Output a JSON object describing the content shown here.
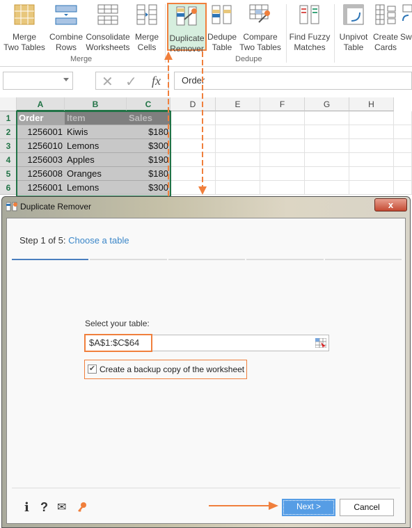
{
  "ribbon": {
    "buttons": [
      {
        "label1": "Merge",
        "label2": "Two Tables",
        "icon": "merge-two-tables-icon"
      },
      {
        "label1": "Combine",
        "label2": "Rows",
        "icon": "combine-rows-icon"
      },
      {
        "label1": "Consolidate",
        "label2": "Worksheets",
        "icon": "consolidate-worksheets-icon"
      },
      {
        "label1": "Merge",
        "label2": "Cells",
        "icon": "merge-cells-icon"
      },
      {
        "label1": "Duplicate",
        "label2": "Remover",
        "icon": "duplicate-remover-icon"
      },
      {
        "label1": "Dedupe",
        "label2": "Table",
        "icon": "dedupe-table-icon"
      },
      {
        "label1": "Compare",
        "label2": "Two Tables",
        "icon": "compare-two-tables-icon"
      },
      {
        "label1": "Find Fuzzy",
        "label2": "Matches",
        "icon": "find-fuzzy-matches-icon"
      },
      {
        "label1": "Unpivot",
        "label2": "Table",
        "icon": "unpivot-table-icon"
      },
      {
        "label1": "Create",
        "label2": "Cards",
        "icon": "create-cards-icon"
      },
      {
        "label1": "Sw",
        "label2": "",
        "icon": "swap-icon"
      }
    ],
    "groups": [
      "Merge",
      "Dedupe"
    ]
  },
  "formula_bar": {
    "name_box": "",
    "fx": "fx",
    "value": "Order"
  },
  "sheet": {
    "columns": [
      "A",
      "B",
      "C",
      "D",
      "E",
      "F",
      "G",
      "H"
    ],
    "rows": [
      "1",
      "2",
      "3",
      "4",
      "5",
      "6"
    ],
    "data": [
      [
        "Order",
        "Item",
        "Sales"
      ],
      [
        "1256001",
        "Kiwis",
        "$180"
      ],
      [
        "1256010",
        "Lemons",
        "$300"
      ],
      [
        "1256003",
        "Apples",
        "$190"
      ],
      [
        "1256008",
        "Oranges",
        "$180"
      ],
      [
        "1256001",
        "Lemons",
        "$300"
      ]
    ]
  },
  "dialog": {
    "title": "Duplicate Remover",
    "close": "x",
    "step_prefix": "Step 1 of 5:",
    "step_name": "Choose a table",
    "steps_total": 5,
    "current_step": 1,
    "select_label": "Select your table:",
    "range_value": "$A$1:$C$64",
    "backup_label": "Create a backup copy of the worksheet",
    "backup_checked": true,
    "footer_icons": [
      "i",
      "?",
      "✉"
    ],
    "next": "Next >",
    "cancel": "Cancel"
  },
  "colors": {
    "accent": "#f07f3c",
    "excel_green": "#217346",
    "link": "#3a86c8",
    "next_bg": "#569de5"
  }
}
